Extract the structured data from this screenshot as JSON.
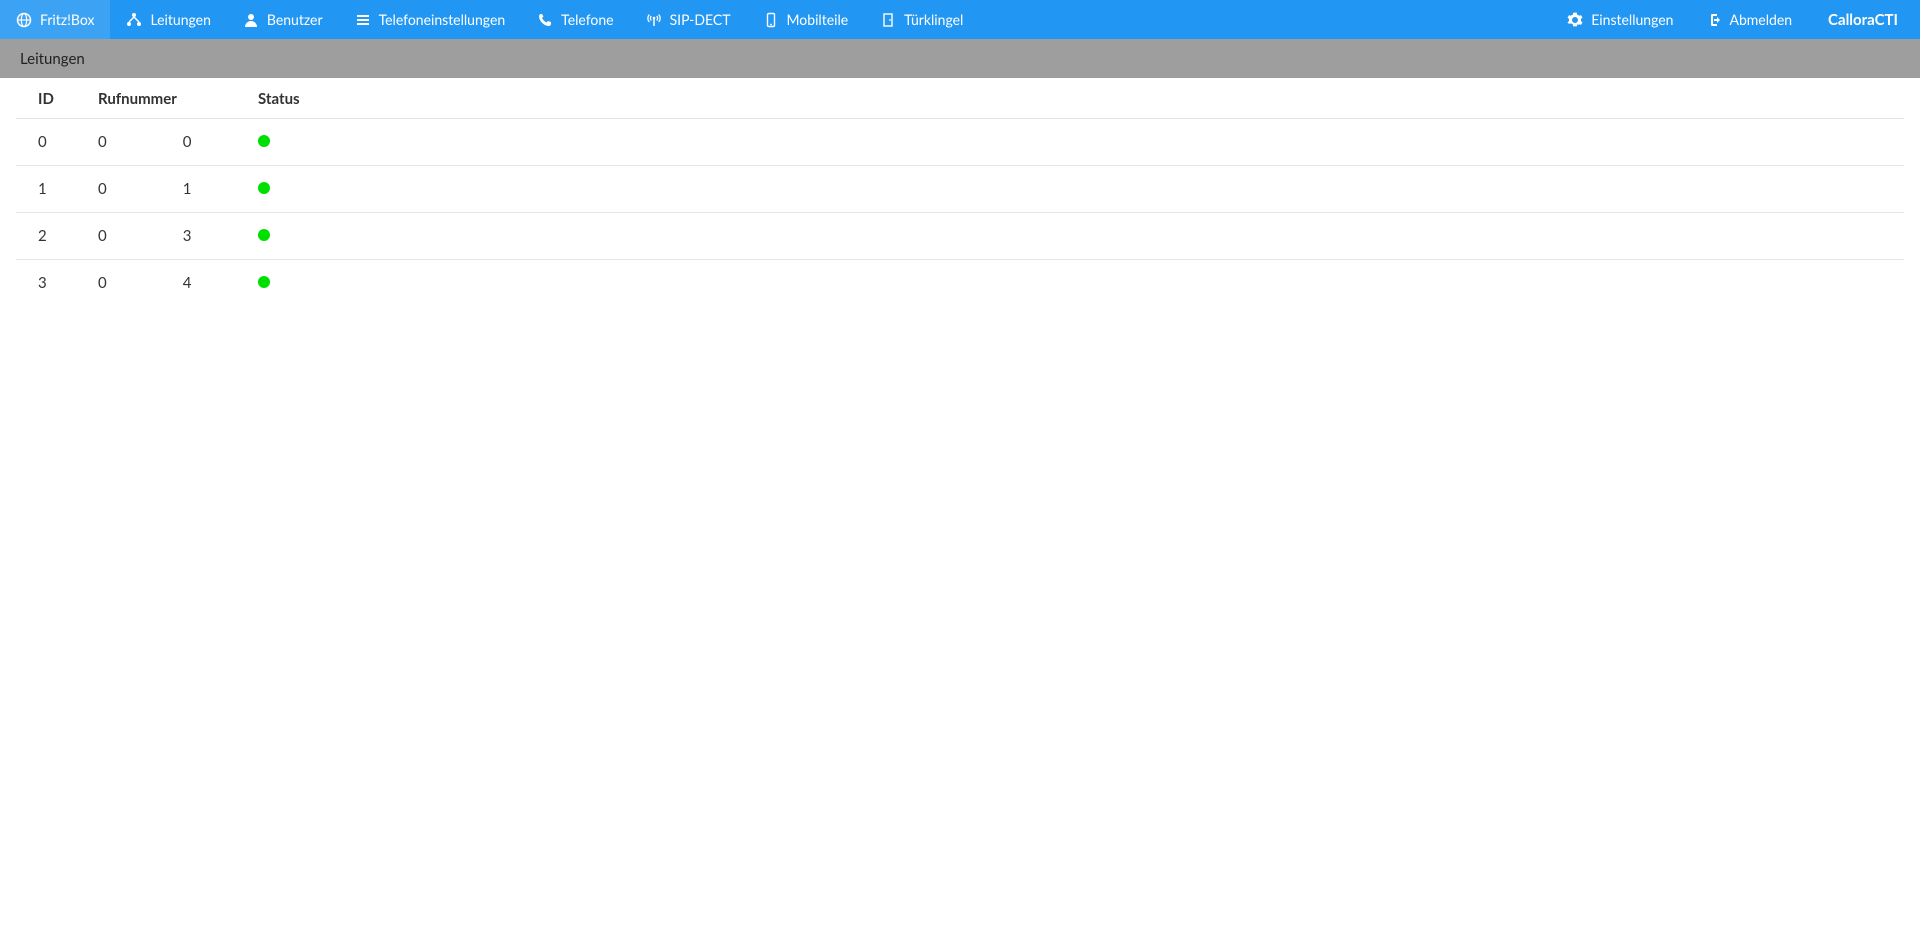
{
  "nav": {
    "left": [
      {
        "key": "fritzbox",
        "label": "Fritz!Box",
        "icon": "globe-icon"
      },
      {
        "key": "leitungen",
        "label": "Leitungen",
        "icon": "network-icon"
      },
      {
        "key": "benutzer",
        "label": "Benutzer",
        "icon": "user-icon"
      },
      {
        "key": "telefoneinstellungen",
        "label": "Telefoneinstellungen",
        "icon": "list-icon"
      },
      {
        "key": "telefone",
        "label": "Telefone",
        "icon": "phone-icon"
      },
      {
        "key": "sipdect",
        "label": "SIP-DECT",
        "icon": "antenna-icon"
      },
      {
        "key": "mobilteile",
        "label": "Mobilteile",
        "icon": "mobile-icon"
      },
      {
        "key": "tuerklingel",
        "label": "Türklingel",
        "icon": "door-icon"
      }
    ],
    "right": [
      {
        "key": "einstellungen",
        "label": "Einstellungen",
        "icon": "gear-icon"
      },
      {
        "key": "abmelden",
        "label": "Abmelden",
        "icon": "signout-icon"
      }
    ],
    "brand": "CalloraCTI"
  },
  "subheader": {
    "title": "Leitungen"
  },
  "table": {
    "headers": {
      "id": "ID",
      "rufnummer": "Rufnummer",
      "status": "Status"
    },
    "rows": [
      {
        "id": "0",
        "rufA": "0",
        "rufB": "0",
        "status": "green"
      },
      {
        "id": "1",
        "rufA": "0",
        "rufB": "1",
        "status": "green"
      },
      {
        "id": "2",
        "rufA": "0",
        "rufB": "3",
        "status": "green"
      },
      {
        "id": "3",
        "rufA": "0",
        "rufB": "4",
        "status": "green"
      }
    ]
  },
  "colors": {
    "navbar": "#2196f3",
    "subheader": "#9e9e9e",
    "status_green": "#00e000"
  }
}
